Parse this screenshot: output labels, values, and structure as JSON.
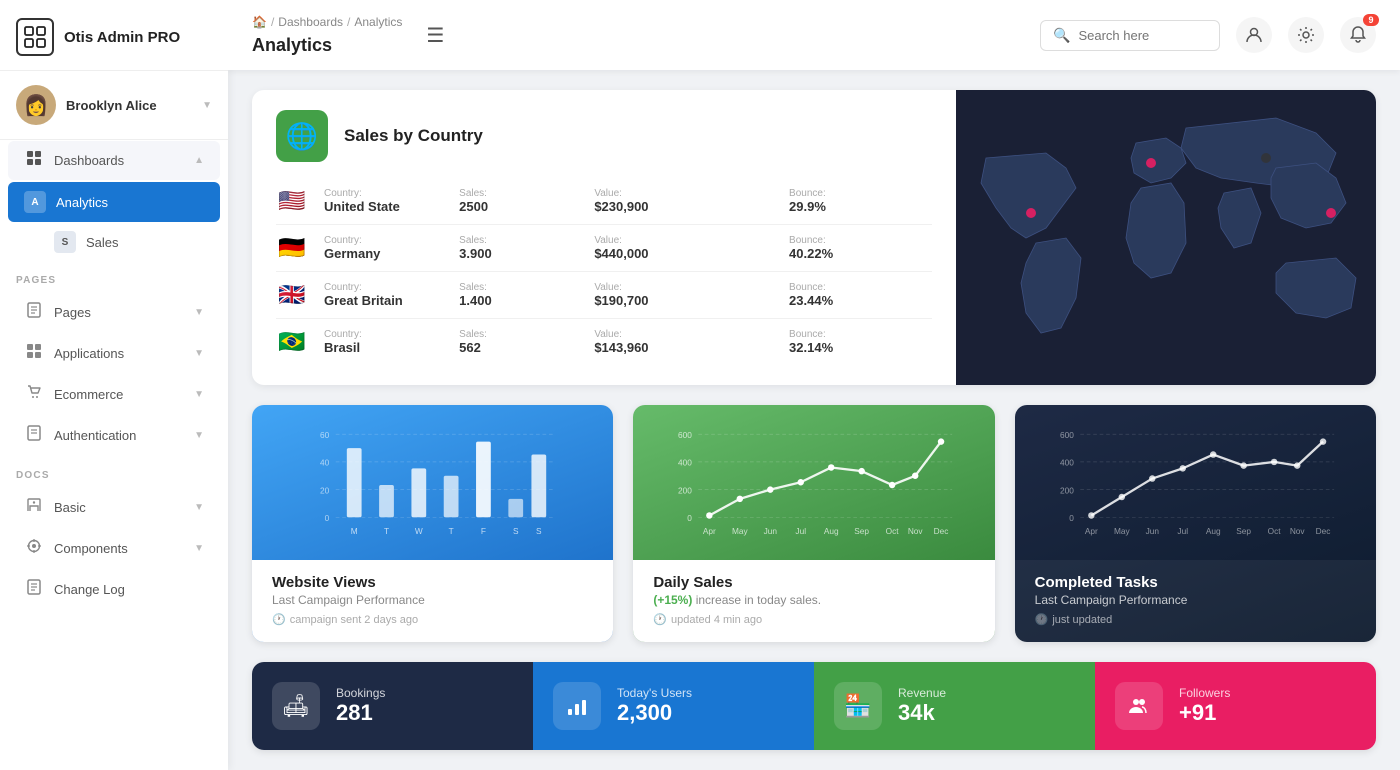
{
  "app": {
    "name": "Otis Admin PRO"
  },
  "user": {
    "name": "Brooklyn Alice"
  },
  "sidebar": {
    "sections": [
      {
        "label": null,
        "items": [
          {
            "id": "dashboards",
            "label": "Dashboards",
            "icon": "⊞",
            "badge": null,
            "active": false,
            "expandable": true,
            "expanded": true,
            "sub": [
              {
                "id": "analytics",
                "label": "Analytics",
                "active": true
              },
              {
                "id": "sales",
                "label": "Sales",
                "active": false
              }
            ]
          }
        ]
      },
      {
        "label": "PAGES",
        "items": [
          {
            "id": "pages",
            "label": "Pages",
            "icon": "🖼",
            "expandable": true
          },
          {
            "id": "applications",
            "label": "Applications",
            "icon": "⬛",
            "expandable": true
          },
          {
            "id": "ecommerce",
            "label": "Ecommerce",
            "icon": "🛍",
            "expandable": true
          },
          {
            "id": "authentication",
            "label": "Authentication",
            "icon": "📋",
            "expandable": true
          }
        ]
      },
      {
        "label": "DOCS",
        "items": [
          {
            "id": "basic",
            "label": "Basic",
            "icon": "📗",
            "expandable": true
          },
          {
            "id": "components",
            "label": "Components",
            "icon": "⚙",
            "expandable": true
          },
          {
            "id": "changelog",
            "label": "Change Log",
            "icon": "📄",
            "expandable": false
          }
        ]
      }
    ]
  },
  "topbar": {
    "breadcrumb": [
      "Home",
      "Dashboards",
      "Analytics"
    ],
    "title": "Analytics",
    "search_placeholder": "Search here",
    "notification_count": "9"
  },
  "sales_by_country": {
    "title": "Sales by Country",
    "columns": [
      "Country:",
      "Sales:",
      "Value:",
      "Bounce:"
    ],
    "rows": [
      {
        "flag": "🇺🇸",
        "country": "United State",
        "sales": "2500",
        "value": "$230,900",
        "bounce": "29.9%"
      },
      {
        "flag": "🇩🇪",
        "country": "Germany",
        "sales": "3.900",
        "value": "$440,000",
        "bounce": "40.22%"
      },
      {
        "flag": "🇬🇧",
        "country": "Great Britain",
        "sales": "1.400",
        "value": "$190,700",
        "bounce": "23.44%"
      },
      {
        "flag": "🇧🇷",
        "country": "Brasil",
        "sales": "562",
        "value": "$143,960",
        "bounce": "32.14%"
      }
    ]
  },
  "charts": {
    "website_views": {
      "title": "Website Views",
      "subtitle": "Last Campaign Performance",
      "meta": "campaign sent 2 days ago",
      "y_labels": [
        "60",
        "40",
        "20",
        "0"
      ],
      "x_labels": [
        "M",
        "T",
        "W",
        "T",
        "F",
        "S",
        "S"
      ],
      "bars": [
        45,
        20,
        32,
        28,
        55,
        12,
        42
      ]
    },
    "daily_sales": {
      "title": "Daily Sales",
      "highlight": "(+15%)",
      "subtitle": "increase in today sales.",
      "meta": "updated 4 min ago",
      "y_labels": [
        "600",
        "400",
        "200",
        "0"
      ],
      "x_labels": [
        "Apr",
        "May",
        "Jun",
        "Jul",
        "Aug",
        "Sep",
        "Oct",
        "Nov",
        "Dec"
      ],
      "points": [
        10,
        80,
        140,
        200,
        310,
        290,
        190,
        250,
        480
      ]
    },
    "completed_tasks": {
      "title": "Completed Tasks",
      "subtitle": "Last Campaign Performance",
      "meta": "just updated",
      "y_labels": [
        "600",
        "400",
        "200",
        "0"
      ],
      "x_labels": [
        "Apr",
        "May",
        "Jun",
        "Jul",
        "Aug",
        "Sep",
        "Oct",
        "Nov",
        "Dec"
      ],
      "points": [
        20,
        120,
        220,
        290,
        380,
        310,
        330,
        300,
        480
      ]
    }
  },
  "stats": [
    {
      "id": "bookings",
      "label": "Bookings",
      "value": "281",
      "icon": "🛋",
      "theme": "dark"
    },
    {
      "id": "today_users",
      "label": "Today's Users",
      "value": "2,300",
      "icon": "📊",
      "theme": "blue"
    },
    {
      "id": "revenue",
      "label": "Revenue",
      "value": "34k",
      "icon": "🏪",
      "theme": "green"
    },
    {
      "id": "followers",
      "label": "Followers",
      "value": "+91",
      "icon": "👥",
      "theme": "pink"
    }
  ]
}
